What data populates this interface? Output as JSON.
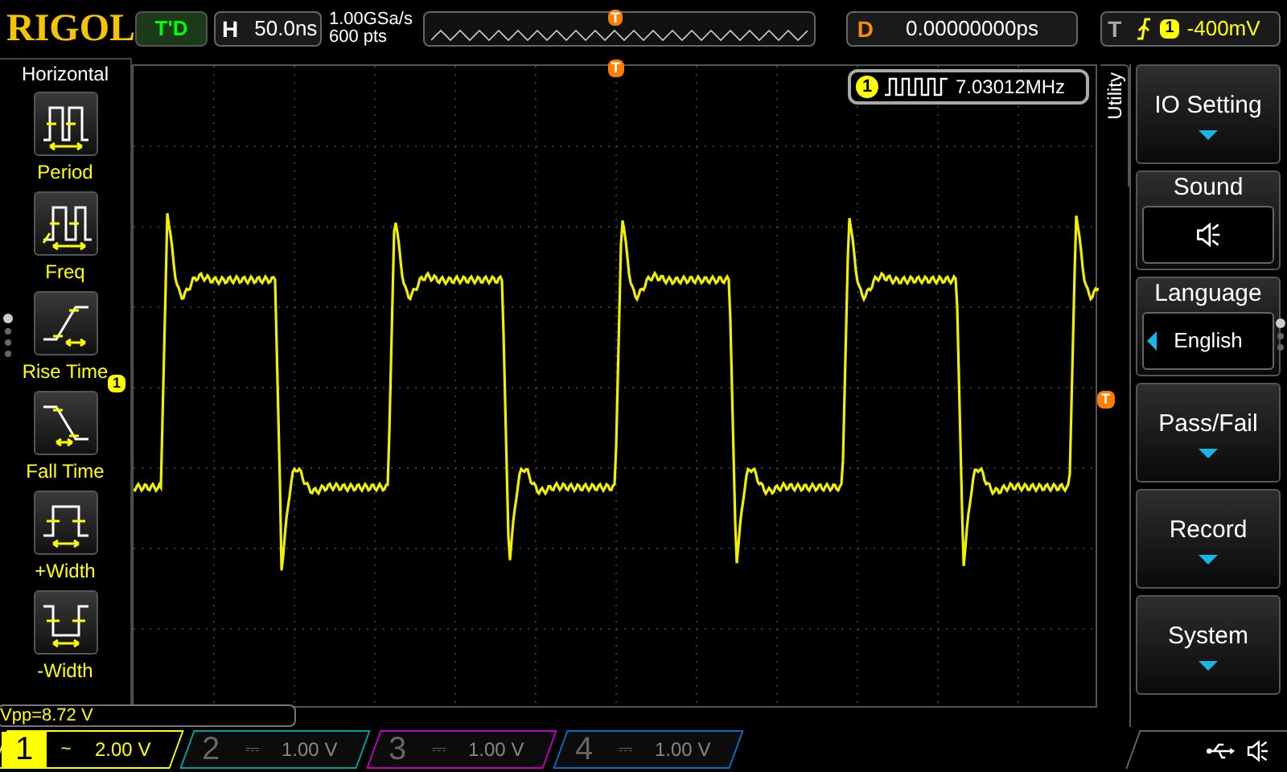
{
  "header": {
    "logo": "RIGOL",
    "run_status": "T'D",
    "timebase": {
      "label": "H",
      "value": "50.0ns"
    },
    "sample_rate": "1.00GSa/s",
    "memory_depth": "600 pts",
    "position_marker": "T",
    "delay": {
      "label": "D",
      "value": "0.00000000ps"
    },
    "trigger": {
      "label": "T",
      "channel": "1",
      "level": "-400mV"
    }
  },
  "left_menu": {
    "title": "Horizontal",
    "items": [
      {
        "label": "Period",
        "kind": "period"
      },
      {
        "label": "Freq",
        "kind": "freq"
      },
      {
        "label": "Rise Time",
        "kind": "rise"
      },
      {
        "label": "Fall Time",
        "kind": "fall"
      },
      {
        "label": "+Width",
        "kind": "pwidth"
      },
      {
        "label": "-Width",
        "kind": "nwidth"
      }
    ],
    "pages": [
      {
        "selected": true
      },
      {
        "selected": false
      },
      {
        "selected": false
      },
      {
        "selected": false
      }
    ]
  },
  "screen": {
    "channel_marker": "1",
    "trigger_level_marker": "T",
    "trigger_position_marker": "T",
    "frequency": {
      "channel": "1",
      "value": "7.03012MHz"
    },
    "measurement": "Vpp=8.72 V"
  },
  "right_menu": {
    "title": "Utility",
    "items": [
      {
        "label": "IO Setting",
        "kind": "submenu"
      },
      {
        "label": "Sound",
        "kind": "sound"
      },
      {
        "label": "Language",
        "kind": "choice",
        "value": "English"
      },
      {
        "label": "Pass/Fail",
        "kind": "submenu"
      },
      {
        "label": "Record",
        "kind": "submenu"
      },
      {
        "label": "System",
        "kind": "submenu"
      }
    ],
    "pages": [
      {
        "selected": true
      },
      {
        "selected": false
      },
      {
        "selected": false
      }
    ]
  },
  "channels": [
    {
      "label": "1",
      "coupling": "~",
      "scale": "2.00 V",
      "on": true,
      "color": "#ffff00"
    },
    {
      "label": "2",
      "coupling": "⎓",
      "scale": "1.00 V",
      "on": false,
      "color": "#00a0a0"
    },
    {
      "label": "3",
      "coupling": "⎓",
      "scale": "1.00 V",
      "on": false,
      "color": "#c000c0"
    },
    {
      "label": "4",
      "coupling": "⎓",
      "scale": "1.00 V",
      "on": false,
      "color": "#0070c0"
    }
  ]
}
